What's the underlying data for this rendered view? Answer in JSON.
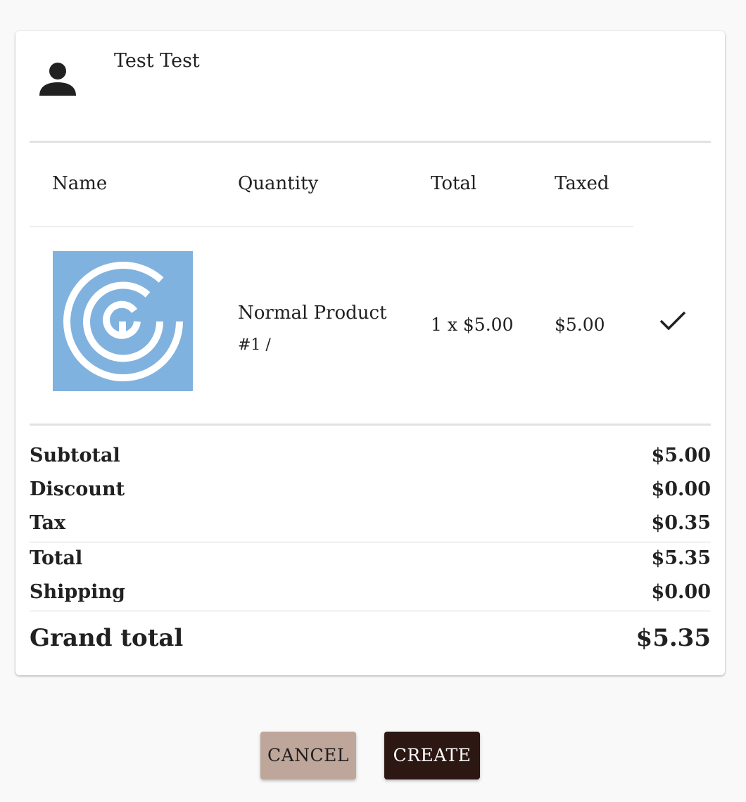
{
  "customer": {
    "name": "Test Test",
    "icon": "person-icon"
  },
  "table": {
    "headers": [
      "Name",
      "Quantity",
      "Total",
      "Taxed"
    ],
    "rows": [
      {
        "image_icon": "product-logo",
        "name": "Normal Product",
        "sku": "#1 /",
        "quantity": "1 x $5.00",
        "total": "$5.00",
        "taxed_icon": "check-icon"
      }
    ]
  },
  "summary": {
    "subtotal_label": "Subtotal",
    "subtotal_value": "$5.00",
    "discount_label": "Discount",
    "discount_value": "$0.00",
    "tax_label": "Tax",
    "tax_value": "$0.35",
    "total_label": "Total",
    "total_value": "$5.35",
    "shipping_label": "Shipping",
    "shipping_value": "$0.00",
    "grand_total_label": "Grand total",
    "grand_total_value": "$5.35"
  },
  "actions": {
    "cancel_label": "CANCEL",
    "create_label": "CREATE"
  },
  "colors": {
    "product_image_bg": "#80b2df",
    "cancel_button": "#bfa69a",
    "create_button": "#2c1712"
  }
}
